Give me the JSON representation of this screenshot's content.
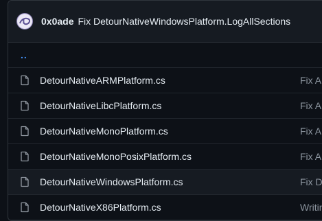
{
  "commit": {
    "author": "0x0ade",
    "message": "Fix DetourNativeWindowsPlatform.LogAllSections"
  },
  "parent_link": "..",
  "files": [
    {
      "name": "DetourNativeARMPlatform.cs",
      "commit": "Fix Ab"
    },
    {
      "name": "DetourNativeLibcPlatform.cs",
      "commit": "Fix Ab"
    },
    {
      "name": "DetourNativeMonoPlatform.cs",
      "commit": "Fix Ab"
    },
    {
      "name": "DetourNativeMonoPosixPlatform.cs",
      "commit": "Fix Ab"
    },
    {
      "name": "DetourNativeWindowsPlatform.cs",
      "commit": "Fix De"
    },
    {
      "name": "DetourNativeX86Platform.cs",
      "commit": "Writin"
    }
  ],
  "icons": {
    "file": "file-icon",
    "avatar": "avatar"
  },
  "colors": {
    "background": "#0d1117",
    "header_bg": "#161b22",
    "border": "#30363d",
    "text": "#e6edf3",
    "muted": "#8d96a0",
    "link": "#4493f8"
  }
}
